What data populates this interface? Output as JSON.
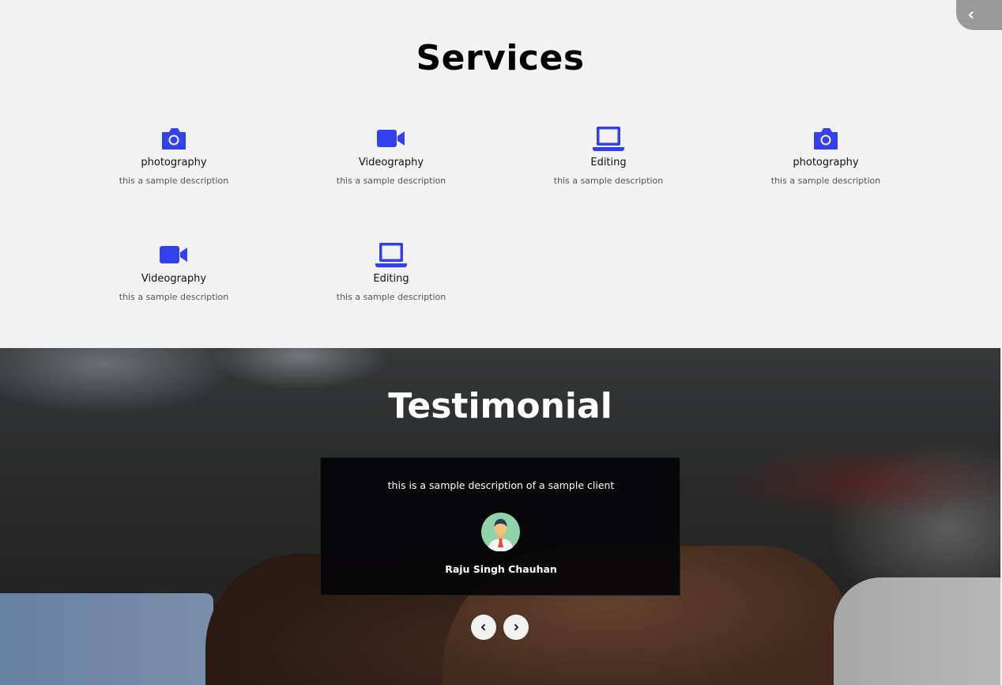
{
  "services": {
    "title": "Services",
    "icon_color": "#3340ee",
    "items": [
      {
        "icon": "camera-icon",
        "name": "photography",
        "desc": "this a sample description"
      },
      {
        "icon": "video-icon",
        "name": "Videography",
        "desc": "this a sample description"
      },
      {
        "icon": "laptop-icon",
        "name": "Editing",
        "desc": "this a sample description"
      },
      {
        "icon": "camera-icon",
        "name": "photography",
        "desc": "this a sample description"
      },
      {
        "icon": "video-icon",
        "name": "Videography",
        "desc": "this a sample description"
      },
      {
        "icon": "laptop-icon",
        "name": "Editing",
        "desc": "this a sample description"
      }
    ]
  },
  "testimonial": {
    "title": "Testimonial",
    "quote": "this is a sample description of a sample client",
    "client_name": "Raju Singh Chauhan",
    "avatar_icon": "avatar-icon",
    "prev_icon": "chevron-left-icon",
    "next_icon": "chevron-right-icon"
  },
  "side_toggle": {
    "icon": "chevron-left-icon"
  }
}
